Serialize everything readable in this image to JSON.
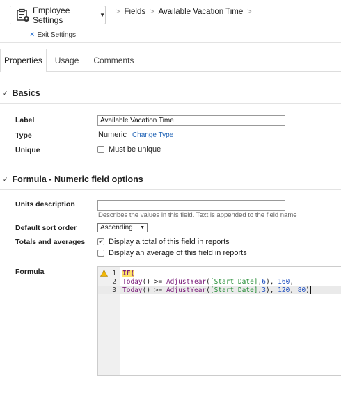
{
  "header": {
    "settings_button": "Employee Settings",
    "breadcrumbs": [
      "Fields",
      "Available Vacation Time"
    ],
    "exit_label": "Exit Settings"
  },
  "tabs": [
    {
      "label": "Properties",
      "active": true
    },
    {
      "label": "Usage",
      "active": false
    },
    {
      "label": "Comments",
      "active": false
    }
  ],
  "basics": {
    "title": "Basics",
    "label_label": "Label",
    "label_value": "Available Vacation Time",
    "type_label": "Type",
    "type_value": "Numeric",
    "change_type_link": "Change Type",
    "unique_label": "Unique",
    "unique_option": "Must be unique",
    "unique_checked": false
  },
  "formula_section": {
    "title": "Formula - Numeric field options",
    "units_label": "Units description",
    "units_value": "",
    "units_help": "Describes the values in this field. Text is appended to the field name",
    "sort_label": "Default sort order",
    "sort_value": "Ascending",
    "totals_label": "Totals and averages",
    "total_option": "Display a total of this field in reports",
    "total_checked": true,
    "average_option": "Display an average of this field in reports",
    "average_checked": false,
    "formula_label": "Formula"
  },
  "editor": {
    "lines": [
      {
        "num": "1",
        "warning": true
      },
      {
        "num": "2",
        "warning": false
      },
      {
        "num": "3",
        "warning": false
      }
    ],
    "line1": {
      "kw": "IF("
    },
    "line2": {
      "fn1": "Today",
      "p1": "() >= ",
      "fn2": "AdjustYear",
      "p2": "(",
      "str": "[Start Date]",
      "p3": ",",
      "n1": "6",
      "p4": "), ",
      "n2": "160",
      "p5": ","
    },
    "line3": {
      "fn1": "Today",
      "p1": "() >= ",
      "fn2": "AdjustYear",
      "p2": "(",
      "str": "[Start Date]",
      "p3": ",",
      "n1": "3",
      "p4": "), ",
      "n2": "120",
      "p5": ", ",
      "n3": "80",
      "p6": ")"
    }
  },
  "colors": {
    "link": "#1a5fb4",
    "keyword_highlight": "#ffe36b",
    "string": "#1e8a2f",
    "number": "#1f4fbf",
    "function": "#7a1c7a"
  }
}
